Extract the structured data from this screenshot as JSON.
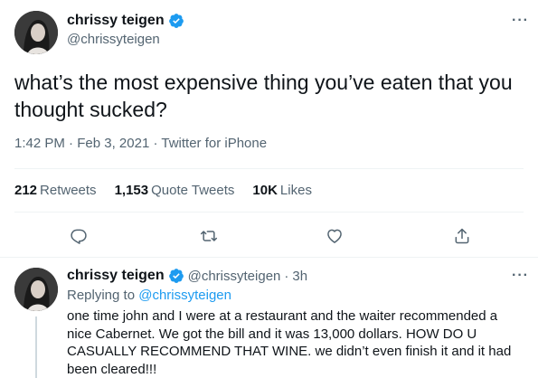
{
  "main_tweet": {
    "display_name": "chrissy teigen",
    "handle": "@chrissyteigen",
    "text": "what’s the most expensive thing you’ve eaten that you thought sucked?",
    "time": "1:42 PM",
    "date": "Feb 3, 2021",
    "source": "Twitter for iPhone",
    "separator": "·",
    "more": "···",
    "stats": {
      "retweets_count": "212",
      "retweets_label": "Retweets",
      "quotes_count": "1,153",
      "quotes_label": "Quote Tweets",
      "likes_count": "10K",
      "likes_label": "Likes"
    }
  },
  "reply_tweet": {
    "display_name": "chrissy teigen",
    "handle": "@chrissyteigen",
    "age": "3h",
    "separator": "·",
    "more": "···",
    "replying_label": "Replying to",
    "replying_to": "@chrissyteigen",
    "text": "one time john and I were at a restaurant and the waiter recommended a nice Cabernet. We got the bill and it was 13,000 dollars. HOW DO U CASUALLY RECOMMEND THAT WINE. we didn’t even finish it and it had been cleared!!!"
  },
  "icons": [
    "reply-icon",
    "retweet-icon",
    "like-icon",
    "share-icon",
    "verified-badge-icon",
    "more-icon"
  ],
  "colors": {
    "accent": "#1d9bf0",
    "text": "#0f1419",
    "secondary": "#536471",
    "divider": "#eff3f4"
  }
}
